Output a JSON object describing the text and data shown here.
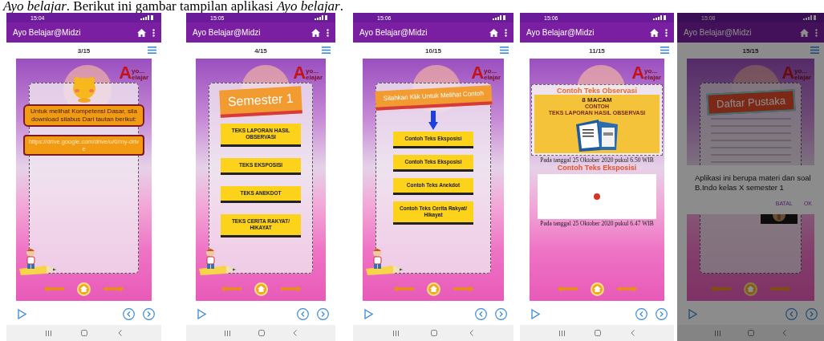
{
  "caption": "*Ayo belajar*. Berikut ini gambar tampilan aplikasi *Ayo belajar*.",
  "phones": [
    {
      "time": "15:04",
      "title": "Ayo Belajar@Midzi",
      "page": "3/15",
      "dimmed": false,
      "slide": {
        "kind": "info",
        "logo": {
          "initial": "A",
          "top": "yo...",
          "bottom": "elajar"
        },
        "message": "Untuk melihat Kompetensi Dasar, sila download silabus Dari tautan berikut:",
        "link": "https://drive.google.com/drive/u/0/my-drive"
      }
    },
    {
      "time": "15:05",
      "title": "Ayo Belajar@Midzi",
      "page": "4/15",
      "dimmed": false,
      "slide": {
        "kind": "menu",
        "logo": {
          "initial": "A",
          "top": "yo...",
          "bottom": "elajar"
        },
        "banner": "Semester 1",
        "arrow": false,
        "items": [
          "TEKS LAPORAN HASIL OBSERVASI",
          "TEKS EKSPOSISI",
          "TEKS ANEKDOT",
          "TEKS CERITA RAKYAT/ HIKAYAT"
        ]
      }
    },
    {
      "time": "15:06",
      "title": "Ayo Belajar@Midzi",
      "page": "10/15",
      "dimmed": false,
      "slide": {
        "kind": "menu",
        "logo": {
          "initial": "A",
          "top": "yo...",
          "bottom": "elajar"
        },
        "banner": "Silahkan Klik Untuk Melihat Contoh",
        "arrow": true,
        "items": [
          "Contoh Teks Eksposisi",
          "Contoh Teks Eksposisi",
          "Contoh Teks Anekdot",
          "Contoh Teks Cerita Rakyat/ Hikayat"
        ]
      }
    },
    {
      "time": "15:06",
      "title": "Ayo Belajar@Midzi",
      "page": "11/15",
      "dimmed": false,
      "slide": {
        "kind": "examples",
        "logo": {
          "initial": "A",
          "top": "yo...",
          "bottom": "elajar"
        },
        "panel_title": "Contoh Teks Observasi",
        "panel_lines": [
          "8 MACAM",
          "CONTOH",
          "TEKS LAPORAN HASIL OBSERVASI"
        ],
        "date_1": "Pada tanggal 25 Oktober 2020 pukul 6.50 WIB",
        "video_title": "Contoh Teks Eksposisi",
        "date_2": "Pada tanggal 25 Oktober 2020 pukul 6.47 WIB"
      }
    },
    {
      "time": "15:08",
      "title": "Ayo Belajar@Midzi",
      "page": "15/15",
      "dimmed": true,
      "slide": {
        "kind": "bibliography",
        "logo": {
          "initial": "A",
          "top": "yo...",
          "bottom": "elajar"
        },
        "banner": "Daftar Pustaka"
      },
      "dialog": {
        "message": "Aplikasi ini berupa materi dan soal B.Indo kelas X semester 1",
        "buttons": [
          "BATAL",
          "OK"
        ]
      }
    }
  ]
}
